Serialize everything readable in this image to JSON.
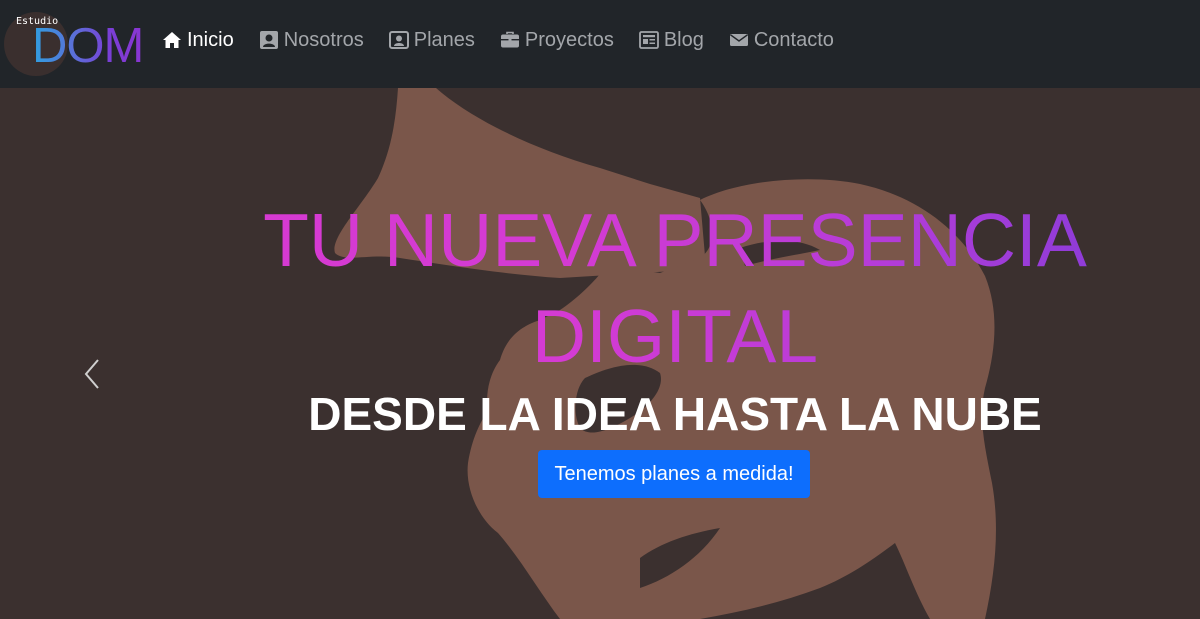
{
  "brand": {
    "small": "Estudio",
    "logo_text": "DOM"
  },
  "nav": {
    "items": [
      {
        "label": "Inicio",
        "icon": "home-icon",
        "active": true
      },
      {
        "label": "Nosotros",
        "icon": "user-icon",
        "active": false
      },
      {
        "label": "Planes",
        "icon": "person-badge-icon",
        "active": false
      },
      {
        "label": "Proyectos",
        "icon": "briefcase-icon",
        "active": false
      },
      {
        "label": "Blog",
        "icon": "newspaper-icon",
        "active": false
      },
      {
        "label": "Contacto",
        "icon": "envelope-icon",
        "active": false
      }
    ]
  },
  "hero": {
    "title": "TU NUEVA PRESENCIA DIGITAL",
    "subtitle": "DESDE LA IDEA HASTA LA NUBE",
    "cta_label": "Tenemos planes a medida!",
    "prev_icon": "chevron-left-icon",
    "illustration": "megaphone-woman-illustration"
  },
  "colors": {
    "navbar_bg": "#212529",
    "hero_bg": "#3b302f",
    "silhouette": "#7a564a",
    "title_gradient_start": "#d63ad2",
    "title_gradient_end": "#7b3bd8",
    "cta_bg": "#0d6efd",
    "nav_active": "#ffffff",
    "nav_inactive": "#a3a6aa"
  }
}
